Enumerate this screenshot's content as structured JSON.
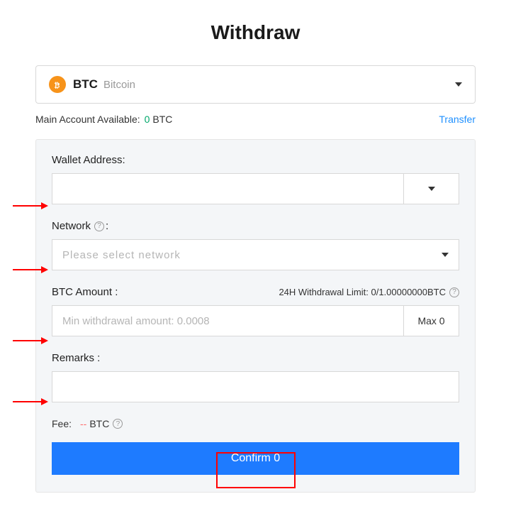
{
  "title": "Withdraw",
  "coin": {
    "symbol": "BTC",
    "name": "Bitcoin"
  },
  "balance": {
    "label": "Main Account Available:",
    "value": "0",
    "unit": "BTC",
    "transfer_label": "Transfer"
  },
  "form": {
    "wallet_address": {
      "label": "Wallet Address:",
      "value": ""
    },
    "network": {
      "label": "Network",
      "placeholder": "Please  select  network"
    },
    "amount": {
      "label": "BTC Amount :",
      "limit_text": "24H Withdrawal Limit: 0/1.00000000BTC",
      "placeholder": "Min withdrawal amount: 0.0008",
      "max_label": "Max 0"
    },
    "remarks": {
      "label": "Remarks :",
      "value": ""
    },
    "fee": {
      "label": "Fee:",
      "dash": "--",
      "unit": "BTC"
    },
    "confirm_label": "Confirm 0"
  }
}
